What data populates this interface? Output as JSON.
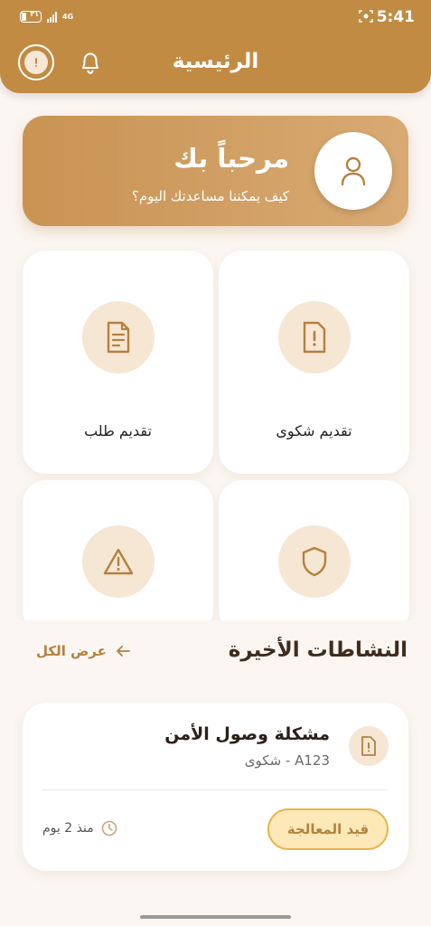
{
  "status_bar": {
    "time": "5:41",
    "battery": "٣١",
    "network": "4G"
  },
  "header": {
    "title": "الرئيسية"
  },
  "welcome": {
    "title": "مرحباً بك",
    "subtitle": "كيف يمكننا مساعدتك اليوم؟"
  },
  "actions": [
    {
      "label": "تقديم شكوى",
      "icon": "complaint-icon"
    },
    {
      "label": "تقديم طلب",
      "icon": "document-icon"
    },
    {
      "label": "",
      "icon": "shield-icon"
    },
    {
      "label": "",
      "icon": "warning-icon"
    }
  ],
  "recent": {
    "title": "النشاطات الأخيرة",
    "view_all": "عرض الكل",
    "items": [
      {
        "title": "مشكلة وصول الأمن",
        "subtitle": "A123 - شكوى",
        "status": "قيد المعالجة",
        "time": "منذ 2 يوم",
        "icon": "complaint-icon"
      }
    ]
  },
  "colors": {
    "primary": "#c18b44",
    "accent_text": "#b3823f",
    "background": "#fbf6f2",
    "icon_bg": "#f6e6d4",
    "status_bg": "#fde9b8",
    "status_border": "#e8b54a"
  }
}
